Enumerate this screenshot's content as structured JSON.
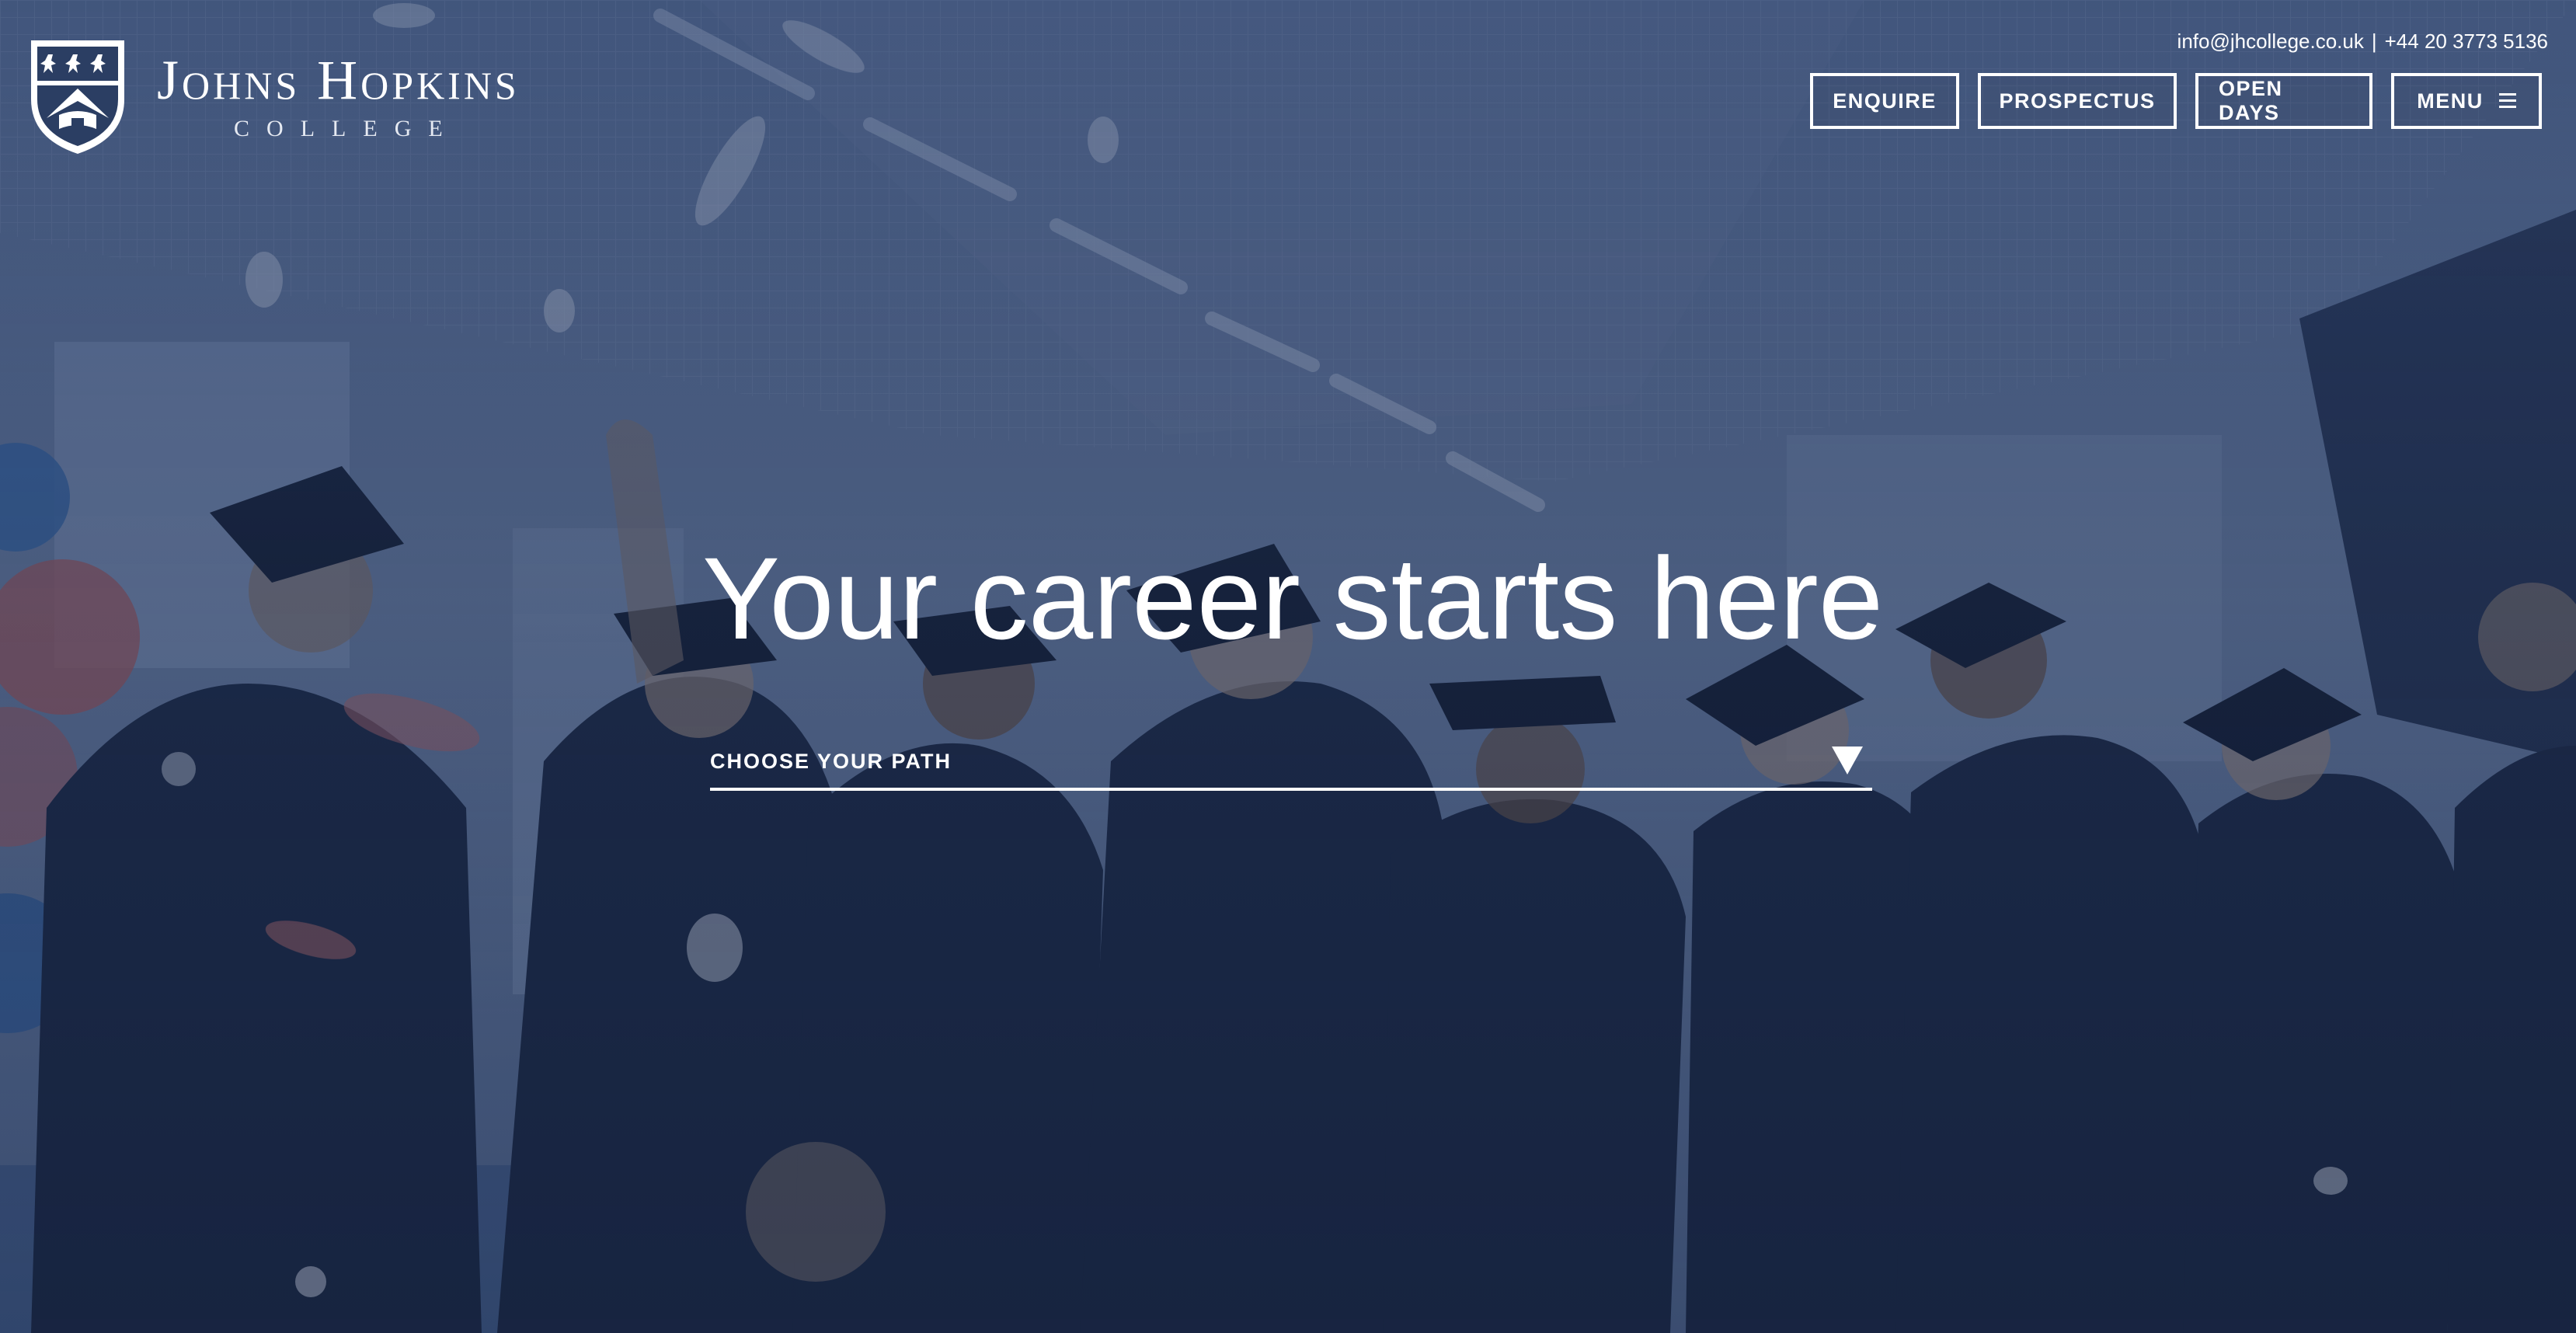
{
  "brand": {
    "name": "Johns Hopkins",
    "subtitle": "COLLEGE",
    "crest_icon": "shield-crest-icon"
  },
  "contact": {
    "email": "info@jhcollege.co.uk",
    "separator": "|",
    "phone": "+44 20 3773 5136"
  },
  "nav": {
    "enquire": "ENQUIRE",
    "prospectus": "PROSPECTUS",
    "open_days": "OPEN DAYS",
    "menu": "MENU",
    "menu_icon": "hamburger-icon"
  },
  "hero": {
    "headline": "Your career starts here",
    "path_select_label": "CHOOSE YOUR PATH",
    "path_select_icon": "caret-down-icon",
    "background_image": "graduates-celebrating-photo"
  },
  "colors": {
    "overlay": "#2c4068",
    "text": "#ffffff"
  }
}
